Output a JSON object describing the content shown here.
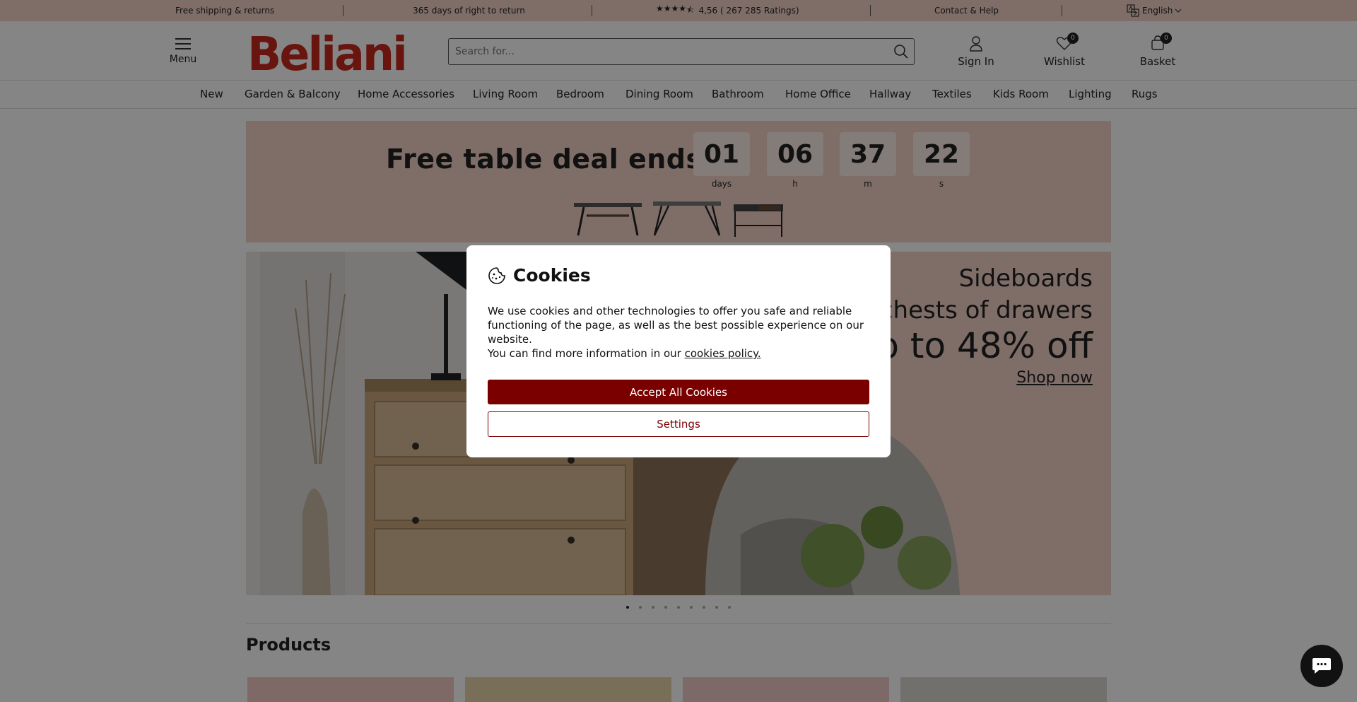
{
  "topbar": {
    "shipping": "Free shipping & returns",
    "returns": "365 days of right to return",
    "rating": "4,56 ( 267 285 Ratings)",
    "contact": "Contact & Help",
    "language": "English"
  },
  "header": {
    "menu_label": "Menu",
    "logo_text": "Beliani",
    "search_placeholder": "Search for...",
    "sign_in": "Sign In",
    "wishlist": "Wishlist",
    "wishlist_count": "0",
    "basket": "Basket",
    "basket_count": "0"
  },
  "nav": {
    "items": [
      "New",
      "Garden & Balcony",
      "Home Accessories",
      "Living Room",
      "Bedroom",
      "Dining Room",
      "Bathroom",
      "Home Office",
      "Hallway",
      "Textiles",
      "Kids Room",
      "Lighting",
      "Rugs"
    ]
  },
  "promo": {
    "title": "Free table deal ends in:",
    "days": "01",
    "days_label": "days",
    "hours": "06",
    "hours_label": "h",
    "minutes": "37",
    "minutes_label": "m",
    "seconds": "22",
    "seconds_label": "s"
  },
  "hero": {
    "line1": "Sideboards",
    "line2": "& chests of drawers",
    "line3": "up to 48% off",
    "cta": "Shop now",
    "slide_count": 9,
    "active_slide": 1
  },
  "products": {
    "title": "Products"
  },
  "cookies": {
    "title": "Cookies",
    "text1": "We use cookies and other technologies to offer you safe and reliable functioning of the page, as well as the best possible experience on our website.",
    "text2_prefix": "You can find more information in our ",
    "policy_link": "cookies policy.",
    "accept": "Accept All Cookies",
    "settings": "Settings"
  },
  "colors": {
    "accent": "#7a0000",
    "logo": "#c8281e",
    "band": "#f3d3c7"
  }
}
